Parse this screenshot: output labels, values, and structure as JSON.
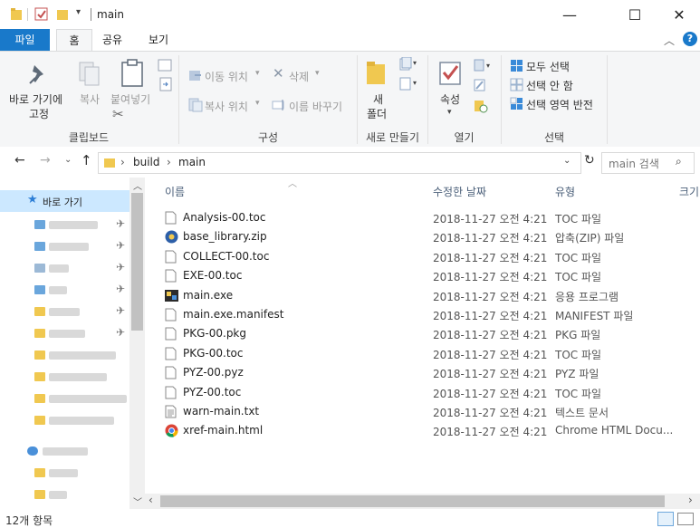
{
  "window": {
    "title": "main",
    "minimize_glyph": "—",
    "maximize_glyph": "☐",
    "close_glyph": "✕"
  },
  "ribbon_tabs": [
    {
      "label": "파일"
    },
    {
      "label": "홈"
    },
    {
      "label": "공유"
    },
    {
      "label": "보기"
    }
  ],
  "ribbon": {
    "pin_label_line1": "바로 가기에",
    "pin_label_line2": "고정",
    "copy_label": "복사",
    "paste_label": "붙여넣기",
    "clipboard_group": "클립보드",
    "move_to_label": "이동 위치",
    "copy_to_label": "복사 위치",
    "delete_label": "삭제",
    "rename_label": "이름 바꾸기",
    "organize_group": "구성",
    "new_folder_line1": "새",
    "new_folder_line2": "폴더",
    "new_group": "새로 만들기",
    "properties_label": "속성",
    "open_group": "열기",
    "select_all_label": "모두 선택",
    "select_none_label": "선택 안 함",
    "invert_selection_label": "선택 영역 반전",
    "select_group": "선택"
  },
  "address": {
    "breadcrumb": [
      "build",
      "main"
    ],
    "search_placeholder": "main 검색"
  },
  "nav_pane": {
    "quick_access_label": "바로 가기"
  },
  "columns": {
    "name": "이름",
    "date": "수정한 날짜",
    "type": "유형",
    "size": "크기"
  },
  "files": [
    {
      "name": "Analysis-00.toc",
      "date": "2018-11-27 오전 4:21",
      "type": "TOC 파일",
      "icon": "file-icon"
    },
    {
      "name": "base_library.zip",
      "date": "2018-11-27 오전 4:21",
      "type": "압축(ZIP) 파일",
      "icon": "zip-icon"
    },
    {
      "name": "COLLECT-00.toc",
      "date": "2018-11-27 오전 4:21",
      "type": "TOC 파일",
      "icon": "file-icon"
    },
    {
      "name": "EXE-00.toc",
      "date": "2018-11-27 오전 4:21",
      "type": "TOC 파일",
      "icon": "file-icon"
    },
    {
      "name": "main.exe",
      "date": "2018-11-27 오전 4:21",
      "type": "응용 프로그램",
      "icon": "exe-icon"
    },
    {
      "name": "main.exe.manifest",
      "date": "2018-11-27 오전 4:21",
      "type": "MANIFEST 파일",
      "icon": "file-icon"
    },
    {
      "name": "PKG-00.pkg",
      "date": "2018-11-27 오전 4:21",
      "type": "PKG 파일",
      "icon": "file-icon"
    },
    {
      "name": "PKG-00.toc",
      "date": "2018-11-27 오전 4:21",
      "type": "TOC 파일",
      "icon": "file-icon"
    },
    {
      "name": "PYZ-00.pyz",
      "date": "2018-11-27 오전 4:21",
      "type": "PYZ 파일",
      "icon": "file-icon"
    },
    {
      "name": "PYZ-00.toc",
      "date": "2018-11-27 오전 4:21",
      "type": "TOC 파일",
      "icon": "file-icon"
    },
    {
      "name": "warn-main.txt",
      "date": "2018-11-27 오전 4:21",
      "type": "텍스트 문서",
      "icon": "text-file-icon"
    },
    {
      "name": "xref-main.html",
      "date": "2018-11-27 오전 4:21",
      "type": "Chrome HTML Docu...",
      "icon": "chrome-icon"
    }
  ],
  "status": {
    "item_count": "12개 항목"
  },
  "colors": {
    "accent": "#1979ca",
    "folder": "#f0c850",
    "header_text": "#4c607a"
  }
}
